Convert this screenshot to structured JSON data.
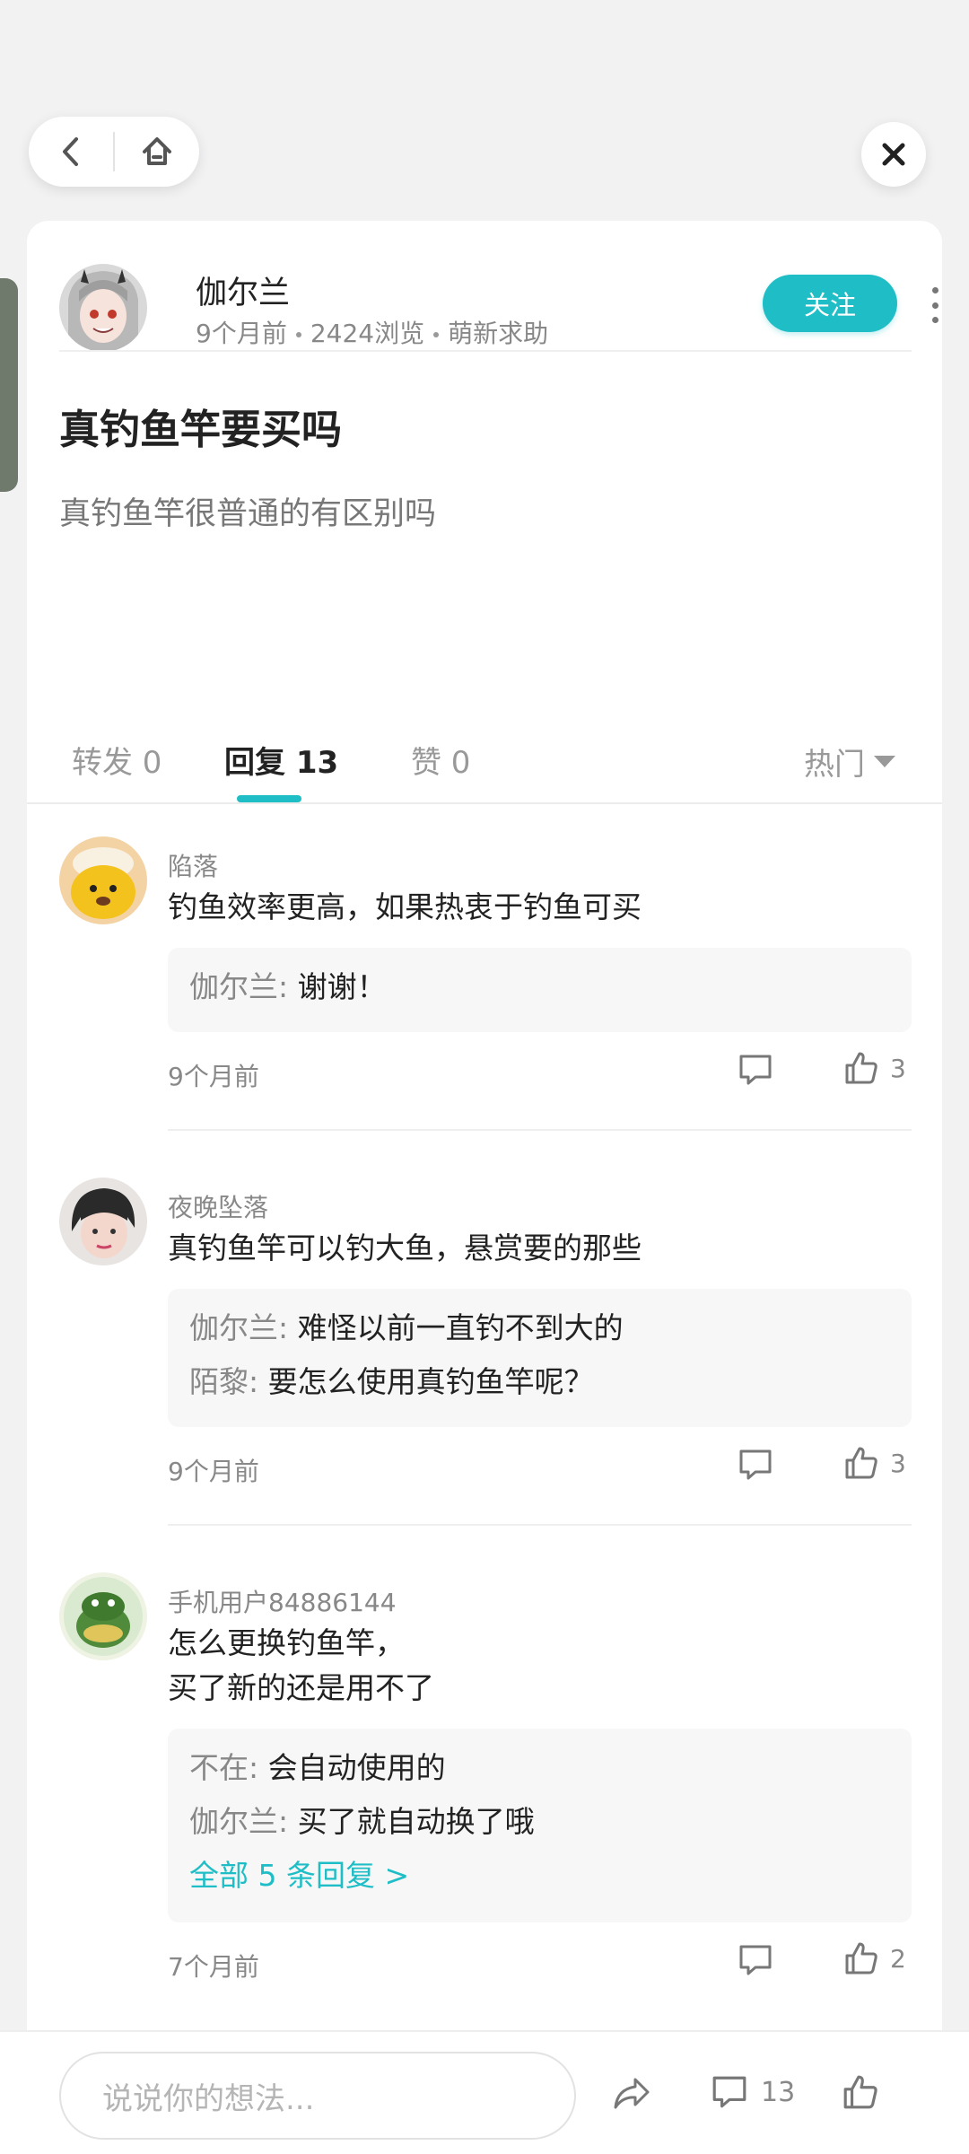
{
  "post": {
    "author_name": "伽尔兰",
    "time": "9个月前",
    "views": "2424浏览",
    "category": "萌新求助",
    "follow_label": "关注",
    "title": "真钓鱼竿要买吗",
    "body": "真钓鱼竿很普通的有区别吗"
  },
  "tabs": [
    {
      "label": "转发 0"
    },
    {
      "label": "回复 13"
    },
    {
      "label": "赞 0"
    }
  ],
  "sort_label": "热门",
  "comments": [
    {
      "user": "陷落",
      "text": "钓鱼效率更高，如果热衷于钓鱼可买",
      "replies": [
        {
          "name": "伽尔兰:",
          "text": " 谢谢！"
        }
      ],
      "time": "9个月前",
      "likes": "3"
    },
    {
      "user": "夜晚坠落",
      "text": "真钓鱼竿可以钓大鱼，悬赏要的那些",
      "replies": [
        {
          "name": "伽尔兰:",
          "text": " 难怪以前一直钓不到大的"
        },
        {
          "name": "陌黎:",
          "text": " 要怎么使用真钓鱼竿呢？"
        }
      ],
      "time": "9个月前",
      "likes": "3"
    },
    {
      "user": "手机用户84886144",
      "text_line1": "怎么更换钓鱼竿，",
      "text_line2": "买了新的还是用不了",
      "replies": [
        {
          "name": "不在:",
          "text": " 会自动使用的"
        },
        {
          "name": "伽尔兰:",
          "text": " 买了就自动换了哦"
        }
      ],
      "all_replies": "全部 5 条回复 >",
      "time": "7个月前",
      "likes": "2"
    }
  ],
  "bottom_bar": {
    "input_placeholder": "说说你的想法...",
    "comment_count": "13"
  },
  "colors": {
    "accent": "#1fbec6",
    "background": "#f2f2f3"
  }
}
